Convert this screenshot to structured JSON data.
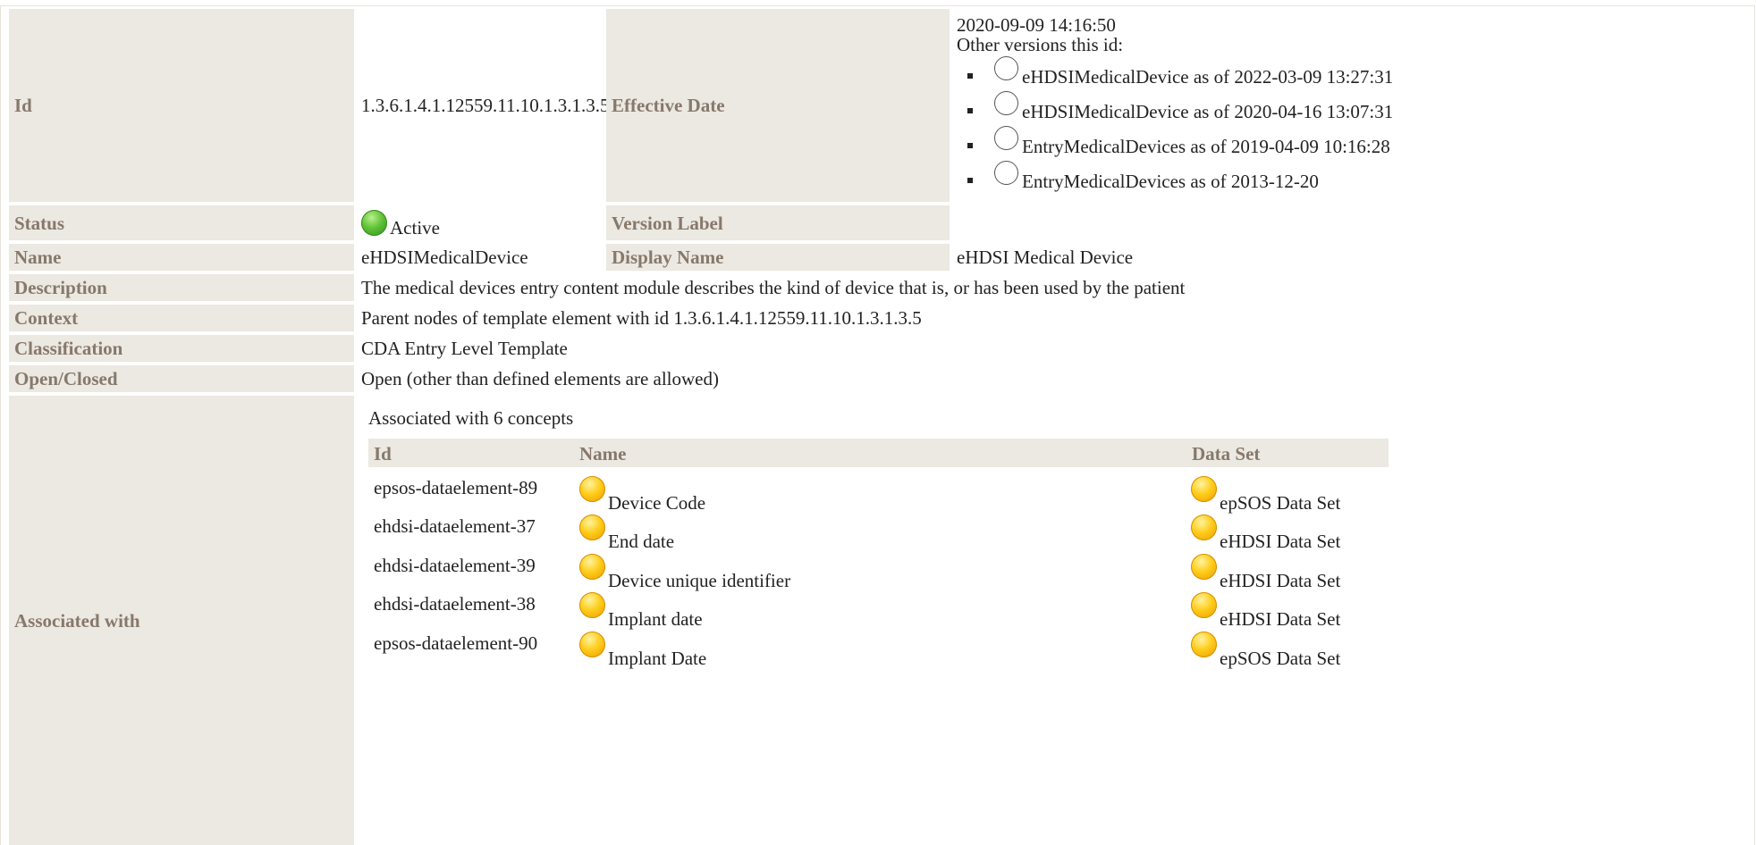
{
  "rows": {
    "id": {
      "label": "Id",
      "value": "1.3.6.1.4.1.12559.11.10.1.3.1.3.5"
    },
    "effective_date": {
      "label": "Effective Date",
      "date": "2020-09-09 14:16:50",
      "other_versions_label": "Other versions this id:",
      "versions": [
        "eHDSIMedicalDevice as of 2022-03-09 13:27:31",
        "eHDSIMedicalDevice as of 2020-04-16 13:07:31",
        "EntryMedicalDevices as of 2019-04-09 10:16:28",
        "EntryMedicalDevices as of 2013-12-20"
      ]
    },
    "status": {
      "label": "Status",
      "value": "Active",
      "icon": "green-status-dot-icon"
    },
    "version_label": {
      "label": "Version Label",
      "value": ""
    },
    "name": {
      "label": "Name",
      "value": "eHDSIMedicalDevice"
    },
    "display_name": {
      "label": "Display Name",
      "value": "eHDSI Medical Device"
    },
    "description": {
      "label": "Description",
      "value": "The medical devices entry content module describes the kind of device that is, or has been used by the patient"
    },
    "context": {
      "label": "Context",
      "value": "Parent nodes of template element with id 1.3.6.1.4.1.12559.11.10.1.3.1.3.5"
    },
    "classification": {
      "label": "Classification",
      "value": "CDA Entry Level Template"
    },
    "open_closed": {
      "label": "Open/Closed",
      "value": "Open (other than defined elements are allowed)"
    },
    "associated_with": {
      "label": "Associated with",
      "summary": "Associated with 6 concepts",
      "columns": [
        "Id",
        "Name",
        "Data Set"
      ],
      "items": [
        {
          "id": "epsos-dataelement-89",
          "name": "Device Code",
          "dataset": "epSOS Data Set"
        },
        {
          "id": "ehdsi-dataelement-37",
          "name": "End date",
          "dataset": "eHDSI Data Set"
        },
        {
          "id": "ehdsi-dataelement-39",
          "name": "Device unique identifier",
          "dataset": "eHDSI Data Set"
        },
        {
          "id": "ehdsi-dataelement-38",
          "name": "Implant date",
          "dataset": "eHDSI Data Set"
        },
        {
          "id": "epsos-dataelement-90",
          "name": "Implant Date",
          "dataset": "epSOS Data Set"
        }
      ]
    }
  },
  "colors": {
    "label_bg": "#ece8e2",
    "label_text": "#86796b",
    "status_active": "#5fc236",
    "concept_dot": "#ffcc1a"
  }
}
